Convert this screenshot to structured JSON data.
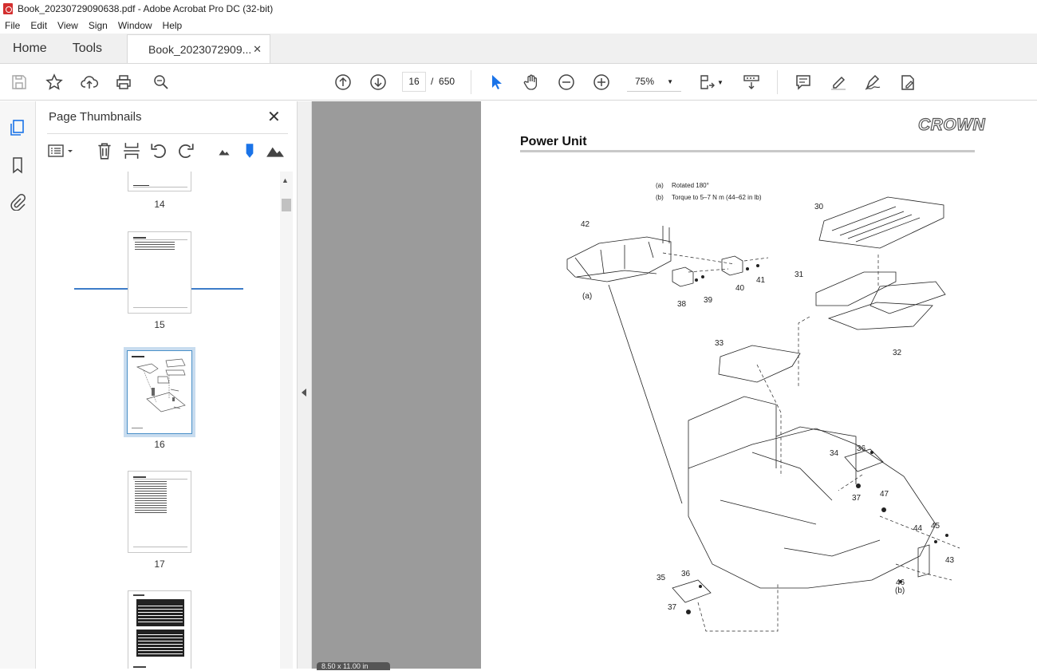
{
  "window": {
    "title": "Book_20230729090638.pdf - Adobe Acrobat Pro DC (32-bit)"
  },
  "menu": [
    "File",
    "Edit",
    "View",
    "Sign",
    "Window",
    "Help"
  ],
  "tabs": {
    "home": "Home",
    "tools": "Tools",
    "document": "Book_2023072909...",
    "close": "✕"
  },
  "toolbar": {
    "current_page": "16",
    "page_sep": "/",
    "total_pages": "650",
    "zoom": "75%"
  },
  "panel": {
    "title": "Page Thumbnails",
    "close": "✕"
  },
  "thumbnails": [
    {
      "label": "14"
    },
    {
      "label": "15"
    },
    {
      "label": "16",
      "selected": true
    },
    {
      "label": "17"
    },
    {
      "label": ""
    }
  ],
  "document_page": {
    "brand": "CROWN",
    "heading": "Power Unit",
    "notes": [
      {
        "key": "(a)",
        "text": "Rotated 180°"
      },
      {
        "key": "(b)",
        "text": "Torque to 5–7 N m (44–62 in lb)"
      }
    ],
    "callouts": [
      "42",
      "(a)",
      "38",
      "39",
      "40",
      "41",
      "30",
      "31",
      "32",
      "33",
      "34",
      "36",
      "37",
      "47",
      "44",
      "45",
      "43",
      "46",
      "(b)",
      "35",
      "36",
      "37"
    ]
  },
  "status": {
    "page_size": "8.50 x 11.00 in"
  }
}
